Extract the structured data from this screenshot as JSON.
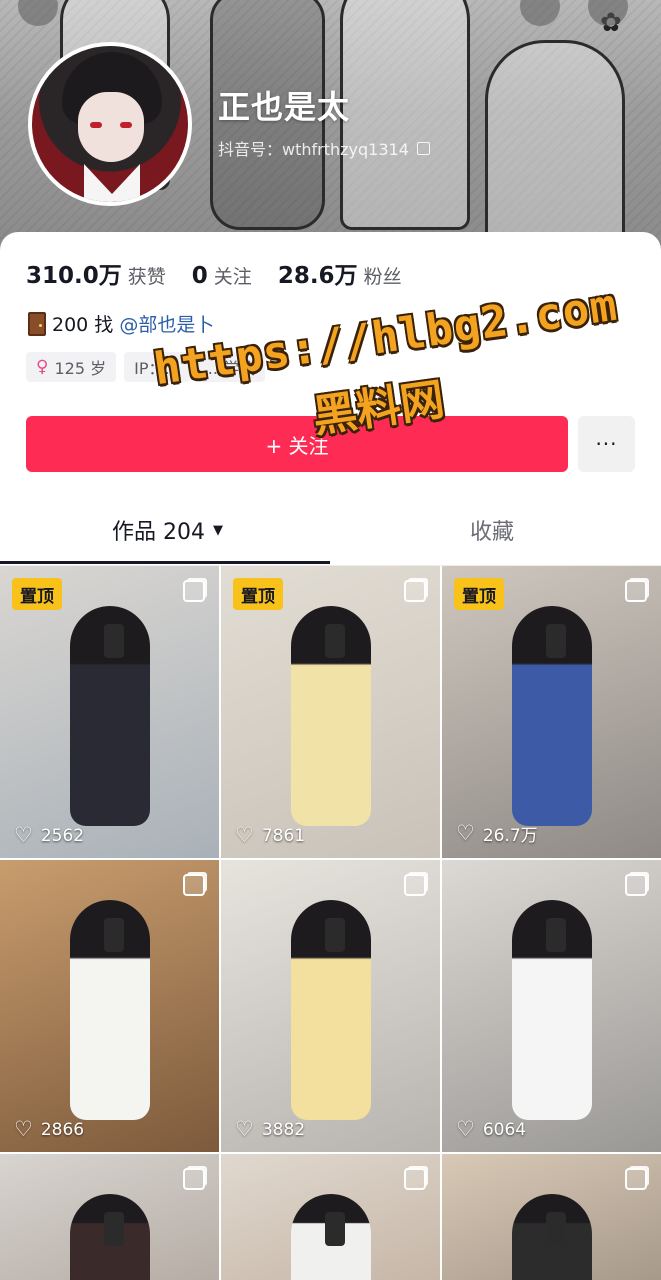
{
  "profile": {
    "nickname": "正也是太",
    "douyin_id": "抖音号：wthfrthzyq1314",
    "stats": [
      {
        "value": "310.0万",
        "label": "获赞"
      },
      {
        "value": "0",
        "label": "关注"
      },
      {
        "value": "28.6万",
        "label": "粉丝"
      }
    ],
    "bio_text": "200 找",
    "bio_mention": "@部也是卜",
    "tags": [
      {
        "icon": "female-icon",
        "text": "125 岁"
      },
      {
        "text": "IP：..."
      },
      {
        "text": "...学校"
      }
    ],
    "follow_label": "+ 关注",
    "more_label": "···"
  },
  "watermark": {
    "url": "https://hlbg2.com",
    "name": "黑料网"
  },
  "tabs": {
    "works_label": "作品 204",
    "favorites_label": "收藏"
  },
  "videos": [
    {
      "pinned": true,
      "pin_label": "置顶",
      "likes": "2562",
      "palette": [
        "#d9d6d2",
        "#a9b1b8",
        "#2a2a35"
      ]
    },
    {
      "pinned": true,
      "pin_label": "置顶",
      "likes": "7861",
      "palette": [
        "#e2ddd4",
        "#c9c2b8",
        "#f1e3a8"
      ]
    },
    {
      "pinned": true,
      "pin_label": "置顶",
      "likes": "26.7万",
      "palette": [
        "#cfc7be",
        "#8f8a86",
        "#3c5aa6"
      ]
    },
    {
      "pinned": false,
      "likes": "2866",
      "palette": [
        "#c89d6e",
        "#7d5a3c",
        "#f4f4f0"
      ]
    },
    {
      "pinned": false,
      "likes": "3882",
      "palette": [
        "#e7e3dd",
        "#b7b3ae",
        "#f3df9e"
      ]
    },
    {
      "pinned": false,
      "likes": "6064",
      "palette": [
        "#dcd8d4",
        "#9a9895",
        "#f5f5f5"
      ]
    },
    {
      "pinned": false,
      "likes": "",
      "palette": [
        "#d8d4d0",
        "#b5aca4",
        "#3a2a2a"
      ]
    },
    {
      "pinned": false,
      "likes": "",
      "palette": [
        "#e0d8cf",
        "#c6b6a6",
        "#f0f0ef"
      ]
    },
    {
      "pinned": false,
      "likes": "",
      "palette": [
        "#d8c9b6",
        "#a6988a",
        "#2c2c2c"
      ]
    }
  ]
}
